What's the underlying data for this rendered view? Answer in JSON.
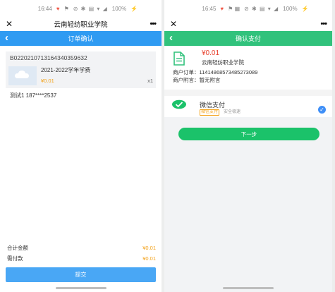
{
  "left": {
    "status": {
      "time": "16:44",
      "battery": "100%"
    },
    "app_title": "云南轻纺职业学院",
    "close_glyph": "✕",
    "more_glyph": "•••",
    "back_glyph": "‹",
    "nav_title": "订单确认",
    "order_no": "B022021071316434035963​2",
    "product": {
      "name": "2021-2022学年学费",
      "price": "¥0.01",
      "qty": "x1"
    },
    "contact": "测试1   187****2537",
    "summary": [
      {
        "label": "合计金额",
        "amount": "¥0.01"
      },
      {
        "label": "需付款",
        "amount": "¥0.01"
      }
    ],
    "submit_label": "提交",
    "colors": {
      "nav": "#2f9bf2",
      "price": "#f3a21a",
      "submit": "#49a7f5"
    }
  },
  "right": {
    "status": {
      "time": "16:45",
      "battery": "100%"
    },
    "close_glyph": "✕",
    "more_glyph": "•••",
    "back_glyph": "‹",
    "nav_title": "确认支付",
    "amount": "¥0.01",
    "school": "云南轻纺职业学院",
    "order_line": "商户订单：114148685734852730​89",
    "note_line": "商户附言：暂无附言",
    "method": {
      "name": "微信支付",
      "tag": "微信支付",
      "sub": "安全极速",
      "icon": "wechat-pay-icon"
    },
    "next_label": "下一步",
    "colors": {
      "nav": "#31c27c",
      "amount": "#e8402c",
      "next": "#1bc26a",
      "check": "#3f8ff7"
    }
  }
}
